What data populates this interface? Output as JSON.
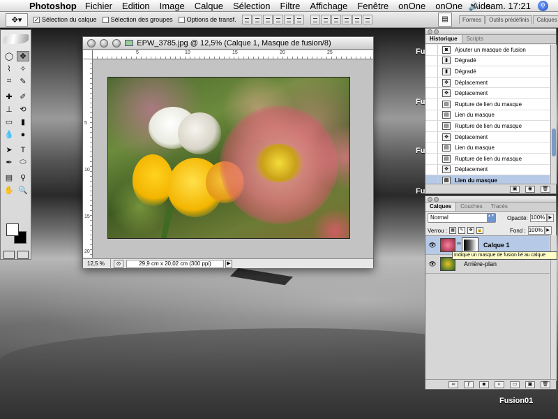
{
  "menubar": {
    "app_name": "Photoshop",
    "items": [
      "Fichier",
      "Edition",
      "Image",
      "Calque",
      "Sélection",
      "Filtre",
      "Affichage",
      "Fenêtre",
      "onOne",
      "onOne",
      "Aide"
    ],
    "clock": "sam. 17:21"
  },
  "options_bar": {
    "auto_select_layer": "Sélection du calque",
    "auto_select_groups": "Sélection des groupes",
    "transform_options": "Options de transf.",
    "palette_well_tabs": [
      "Formes",
      "Outils prédéfinis",
      "Calques"
    ]
  },
  "document": {
    "title": "EPW_3785.jpg @ 12,5% (Calque 1, Masque de fusion/8)",
    "zoom": "12,5 %",
    "info": "29,9 cm x 20,02 cm (300 ppi)",
    "ruler_h": [
      "5",
      "10",
      "15",
      "20",
      "25"
    ],
    "ruler_v": [
      "5",
      "10",
      "15",
      "20"
    ]
  },
  "history": {
    "tabs": [
      "Historique",
      "Scripts"
    ],
    "items": [
      {
        "label": "Ajouter un masque de fusion",
        "icon": "mask"
      },
      {
        "label": "Dégradé",
        "icon": "gradient"
      },
      {
        "label": "Dégradé",
        "icon": "gradient"
      },
      {
        "label": "Déplacement",
        "icon": "move"
      },
      {
        "label": "Déplacement",
        "icon": "move"
      },
      {
        "label": "Rupture de lien du masque",
        "icon": "doc"
      },
      {
        "label": "Lien du masque",
        "icon": "doc"
      },
      {
        "label": "Rupture de lien du masque",
        "icon": "doc"
      },
      {
        "label": "Déplacement",
        "icon": "move"
      },
      {
        "label": "Lien du masque",
        "icon": "doc"
      },
      {
        "label": "Rupture de lien du masque",
        "icon": "doc"
      },
      {
        "label": "Déplacement",
        "icon": "move"
      },
      {
        "label": "Lien du masque",
        "icon": "doc",
        "selected": true
      }
    ]
  },
  "layers": {
    "tabs": [
      "Calques",
      "Couches",
      "Tracés"
    ],
    "blend_mode": "Normal",
    "opacity_label": "Opacité:",
    "opacity": "100%",
    "lock_label": "Verrou :",
    "fill_label": "Fond :",
    "fill": "100%",
    "rows": [
      {
        "name": "Calque 1",
        "selected": true
      },
      {
        "name": "Arrière-plan",
        "selected": false
      }
    ]
  },
  "tooltip": "Indique un masque de fusion lié au calque",
  "desktop_labels": [
    "Fusion01",
    "Fusi",
    "Fusi",
    "Fusi",
    "Fusi"
  ],
  "colors": {
    "selection": "#b6c9e6",
    "tooltip_bg": "#ffffc6",
    "foreground": "#ffffff",
    "background": "#000000"
  }
}
